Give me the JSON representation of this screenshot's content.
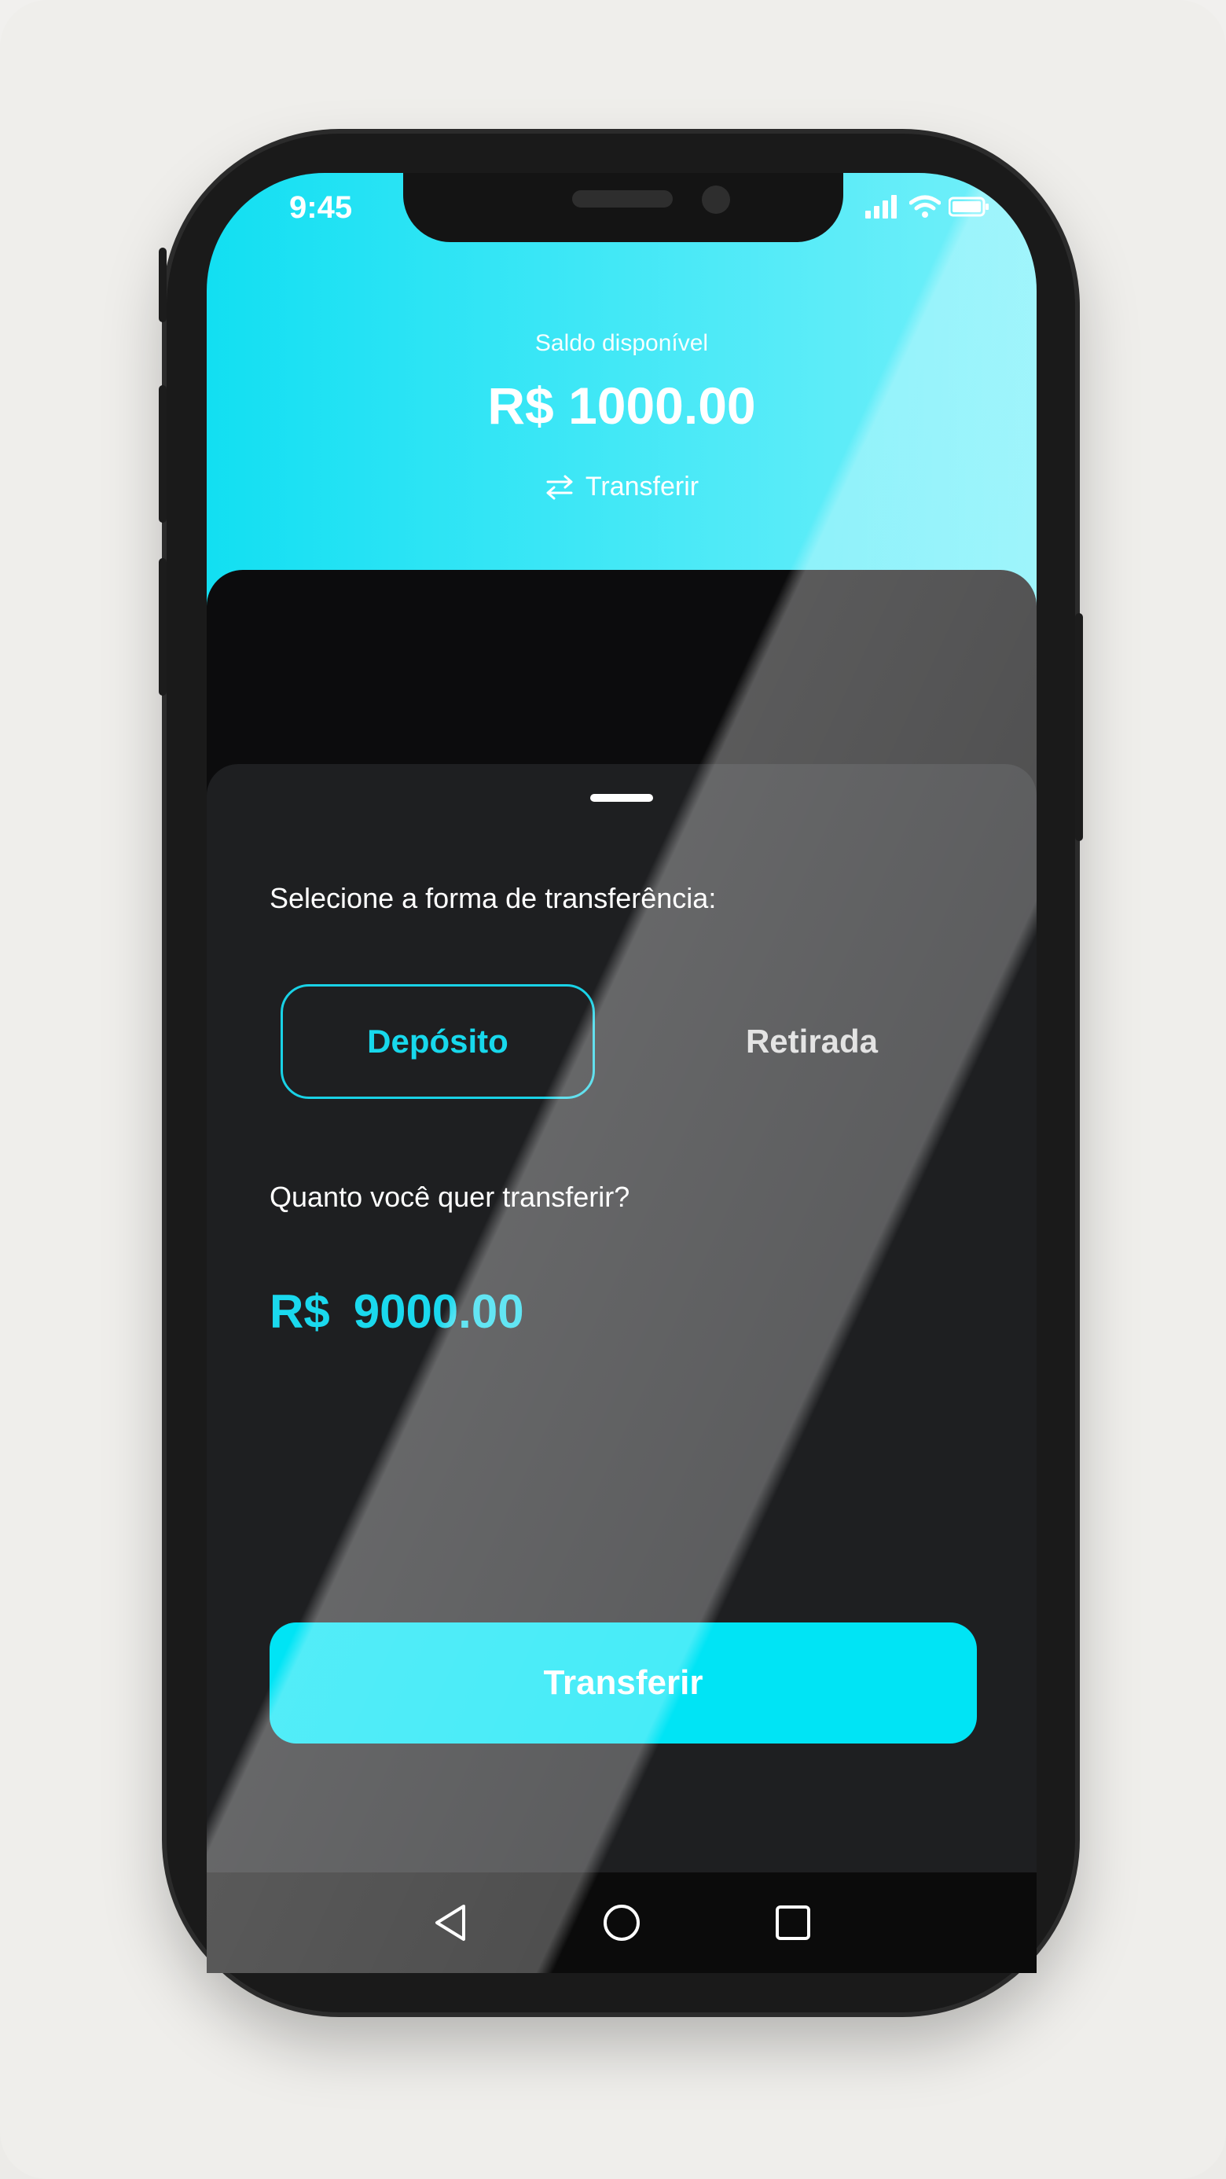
{
  "status_bar": {
    "time": "9:45"
  },
  "header": {
    "balance_label": "Saldo disponível",
    "balance_value": "R$ 1000.00",
    "transfer_link": "Transferir"
  },
  "sheet": {
    "select_label": "Selecione a forma de transferência:",
    "options": [
      {
        "label": "Depósito",
        "selected": true
      },
      {
        "label": "Retirada",
        "selected": false
      }
    ],
    "amount_label": "Quanto você quer transferir?",
    "amount_currency": "R$",
    "amount_value": "9000.00",
    "cta_label": "Transferir"
  },
  "colors": {
    "accent": "#00e4f5",
    "header_gradient_start": "#12dff2",
    "header_gradient_end": "#75f0fa",
    "sheet_bg": "#1e1f21"
  },
  "icons": [
    "transfer-arrows-icon",
    "signal-icon",
    "wifi-icon",
    "battery-icon",
    "back-icon",
    "home-icon",
    "recents-icon"
  ]
}
